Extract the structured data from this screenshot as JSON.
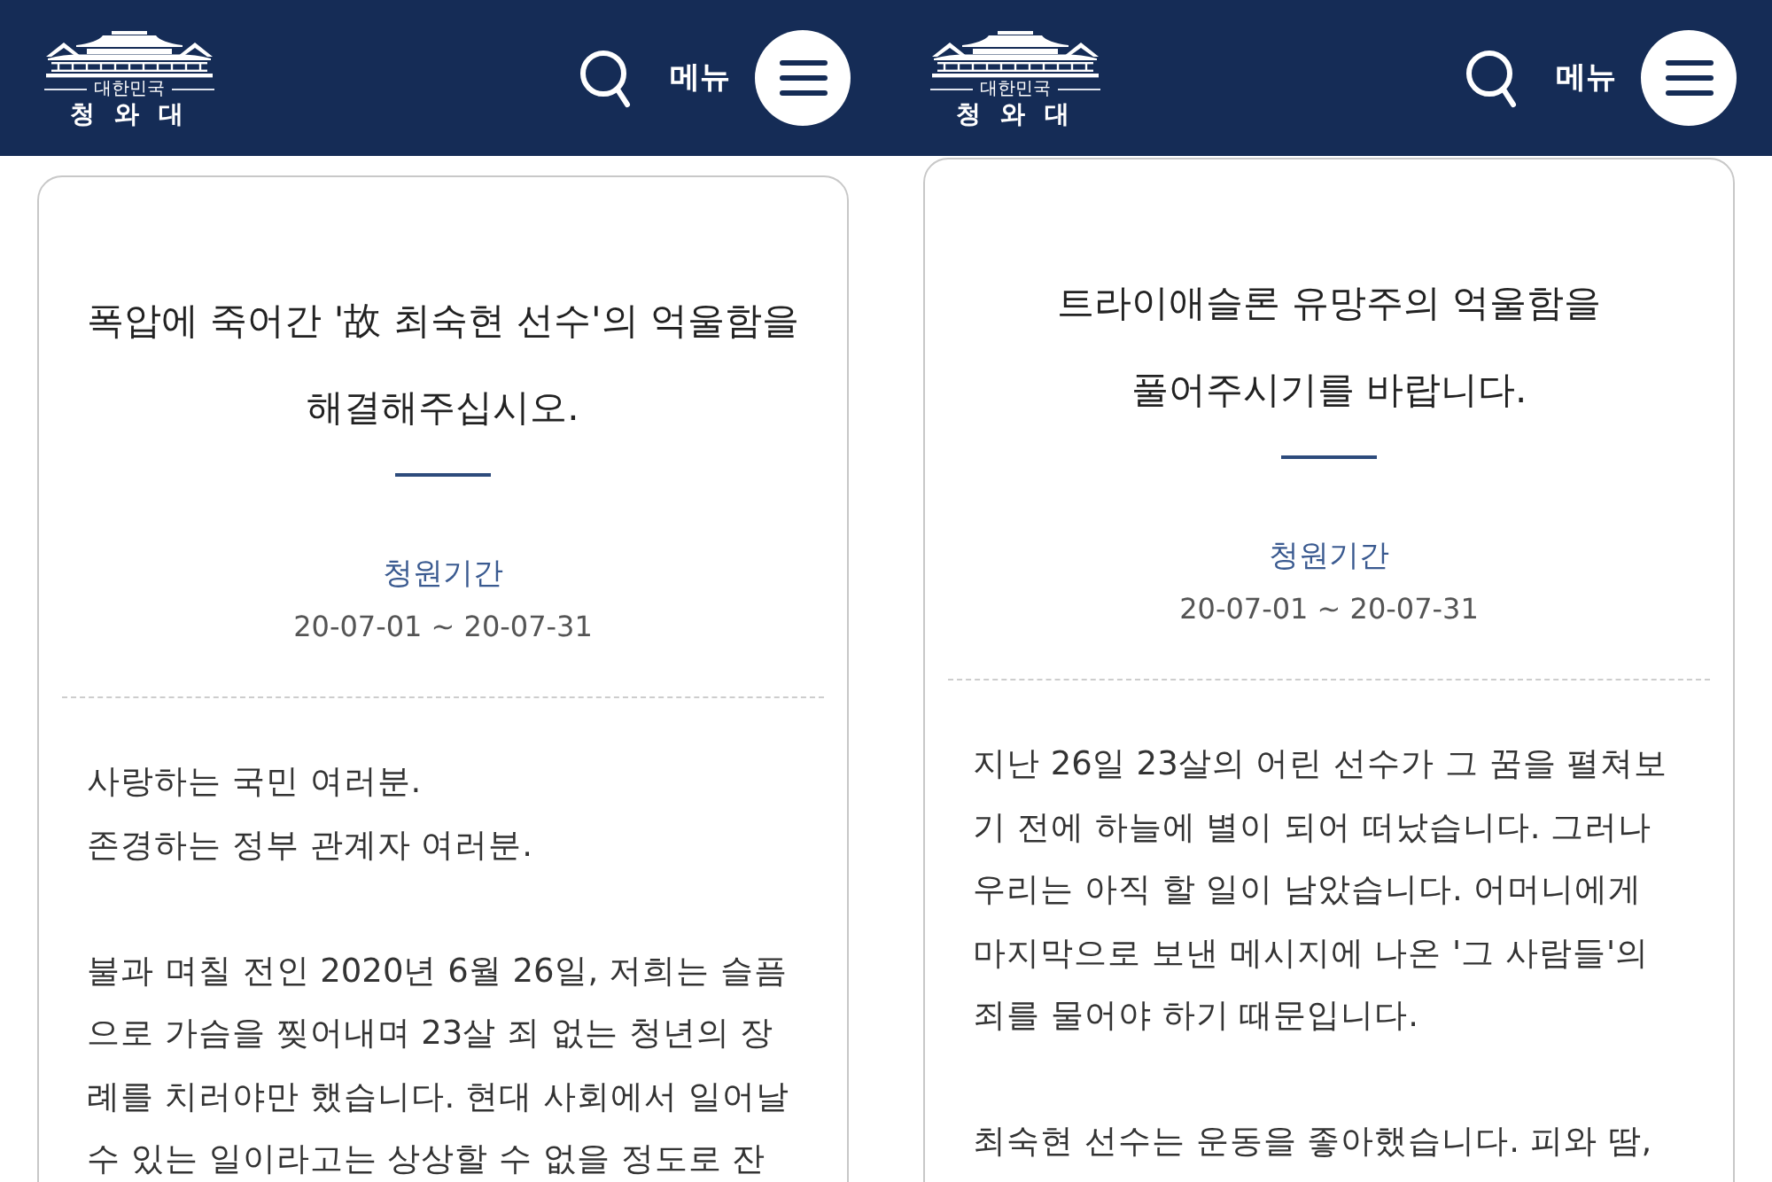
{
  "panels": [
    {
      "header": {
        "logo_subtitle": "대한민국",
        "logo_title": "청 와 대",
        "menu_label": "메뉴"
      },
      "petition": {
        "title": [
          "폭압에 죽어간 '故 최숙현 선수'의 억울함을",
          "해결해주십시오."
        ],
        "period_label": "청원기간",
        "period": "20-07-01 ~ 20-07-31",
        "paragraphs": [
          {
            "lines": [
              "사랑하는 국민 여러분.",
              "존경하는 정부 관계자 여러분."
            ]
          },
          {
            "lines": [
              "불과 며칠 전인 2020년 6월 26일, 저희는 슬픔",
              "으로 가슴을 찢어내며 23살 죄 없는 청년의 장",
              "례를 치러야만 했습니다. 현대 사회에서 일어날",
              "수 있는 일이라고는 상상할 수 없을 정도로 잔"
            ]
          }
        ]
      }
    },
    {
      "header": {
        "logo_subtitle": "대한민국",
        "logo_title": "청 와 대",
        "menu_label": "메뉴"
      },
      "petition": {
        "title": [
          "트라이애슬론 유망주의 억울함을",
          "풀어주시기를 바랍니다."
        ],
        "period_label": "청원기간",
        "period": "20-07-01 ~ 20-07-31",
        "paragraphs": [
          {
            "lines": [
              "지난 26일 23살의 어린 선수가 그 꿈을 펼쳐보",
              "기 전에 하늘에 별이 되어 떠났습니다. 그러나",
              "우리는 아직 할 일이 남았습니다. 어머니에게",
              "마지막으로 보낸 메시지에 나온 '그 사람들'의",
              "죄를 물어야 하기 때문입니다."
            ]
          },
          {
            "lines": [
              "최숙현 선수는 운동을 좋아했습니다. 피와 땀,"
            ]
          }
        ]
      }
    }
  ]
}
